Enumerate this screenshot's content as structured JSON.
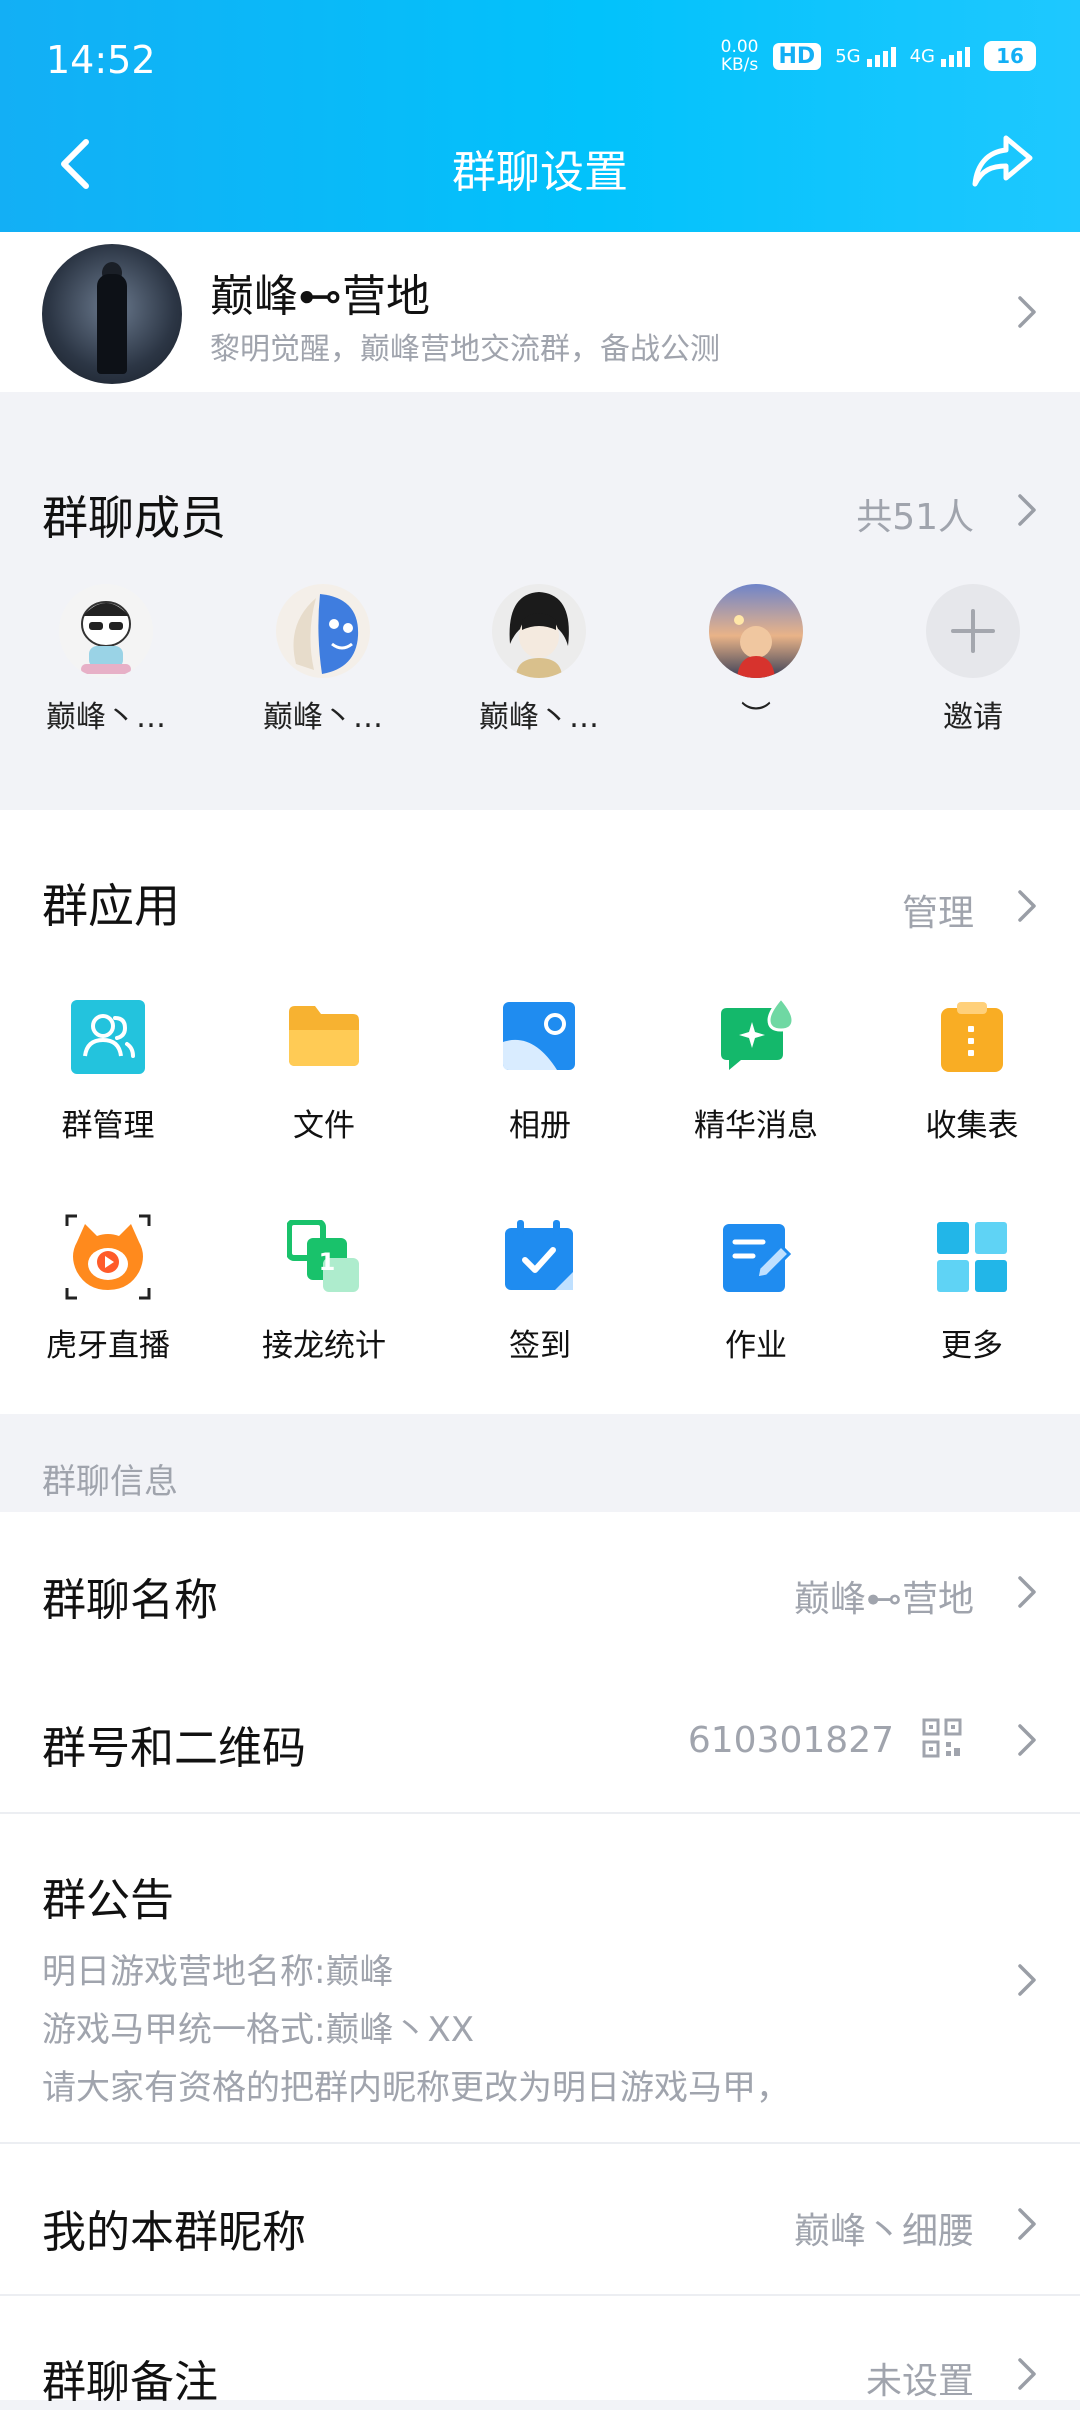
{
  "status_bar": {
    "time": "14:52",
    "net_speed_top": "0.00",
    "net_speed_bottom": "KB/s",
    "hd_label": "HD",
    "net1": "5G",
    "net2": "4G",
    "battery": "16"
  },
  "nav": {
    "title": "群聊设置"
  },
  "group": {
    "name": "巅峰⊷营地",
    "description": "黎明觉醒，巅峰营地交流群，备战公测"
  },
  "members": {
    "title": "群聊成员",
    "count": "共51人",
    "list": [
      {
        "name": "巅峰丶…"
      },
      {
        "name": "巅峰丶…"
      },
      {
        "name": "巅峰丶…"
      },
      {
        "name": "︶"
      },
      {
        "name": "邀请"
      }
    ]
  },
  "apps": {
    "title": "群应用",
    "manage": "管理",
    "items": [
      {
        "label": "群管理",
        "icon": "group-manage-icon"
      },
      {
        "label": "文件",
        "icon": "folder-icon"
      },
      {
        "label": "相册",
        "icon": "album-icon"
      },
      {
        "label": "精华消息",
        "icon": "essence-message-icon"
      },
      {
        "label": "收集表",
        "icon": "clipboard-icon"
      },
      {
        "label": "虎牙直播",
        "icon": "huya-live-icon"
      },
      {
        "label": "接龙统计",
        "icon": "relay-stats-icon"
      },
      {
        "label": "签到",
        "icon": "checkin-icon"
      },
      {
        "label": "作业",
        "icon": "homework-icon"
      },
      {
        "label": "更多",
        "icon": "more-grid-icon"
      }
    ]
  },
  "info": {
    "header": "群聊信息",
    "name_label": "群聊名称",
    "name_value": "巅峰⊷营地",
    "id_label": "群号和二维码",
    "id_value": "610301827",
    "notice_label": "群公告",
    "notice_lines": [
      "明日游戏营地名称:巅峰",
      "游戏马甲统一格式:巅峰丶XX",
      "请大家有资格的把群内昵称更改为明日游戏马甲，"
    ],
    "nickname_label": "我的本群昵称",
    "nickname_value": "巅峰丶细腰",
    "remark_label": "群聊备注",
    "remark_value": "未设置"
  }
}
